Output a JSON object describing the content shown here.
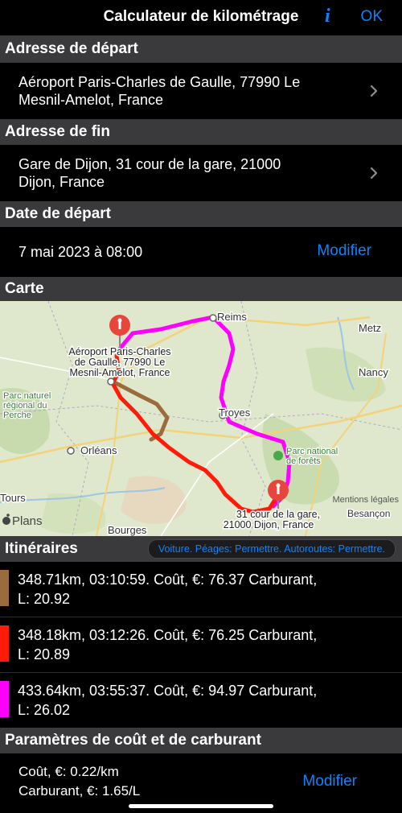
{
  "nav": {
    "title": "Calculateur de kilométrage",
    "info_label": "i",
    "ok_label": "OK"
  },
  "start": {
    "header": "Adresse de départ",
    "line1": "Aéroport Paris-Charles de Gaulle, 77990 Le",
    "line2": "Mesnil-Amelot, France"
  },
  "end": {
    "header": "Adresse de fin",
    "line1": "Gare de Dijon, 31 cour de la gare, 21000",
    "line2": "Dijon, France"
  },
  "date": {
    "header": "Date de départ",
    "value": "7 mai 2023 à 08:00",
    "edit_label": "Modifier"
  },
  "map": {
    "header": "Carte",
    "cities": {
      "reims": "Reims",
      "metz": "Metz",
      "nancy": "Nancy",
      "troyes": "Troyes",
      "orleans": "Orléans",
      "tours": "Tours",
      "bourges": "Bourges",
      "besancon": "Besançon",
      "parc_perche_1": "Parc naturel",
      "parc_perche_2": "régional du",
      "parc_perche_3": "Perche",
      "parc_forets_1": "Parc national",
      "parc_forets_2": "de forêts"
    },
    "start_label": {
      "line1": "Aéroport Paris-Charles",
      "line2": "de Gaulle, 77990 Le",
      "line3": "Mesnil-Amelot, France"
    },
    "end_label": {
      "line1": "31 cour de la gare,",
      "line2": "21000 Dijon, France"
    },
    "attribution": "Plans",
    "legal": "Mentions légales"
  },
  "itineraries": {
    "header": "Itinéraires",
    "options": "Voiture. Péages: Permettre. Autoroutes: Permettre.",
    "routes": [
      {
        "color": "#9a6b3c",
        "line1": "348.71km, 03:10:59. Coût, €: 76.37 Carburant,",
        "line2": "L: 20.92"
      },
      {
        "color": "#ff1a0a",
        "line1": "348.18km, 03:12:26. Coût, €: 76.25 Carburant,",
        "line2": "L: 20.89"
      },
      {
        "color": "#ff00ff",
        "line1": "433.64km, 03:55:37. Coût, €: 94.97 Carburant,",
        "line2": "L: 26.02"
      }
    ]
  },
  "cost": {
    "header": "Paramètres de coût et de carburant",
    "line1": "Coût, €: 0.22/km",
    "line2": "Carburant, €: 1.65/L",
    "edit_label": "Modifier"
  }
}
